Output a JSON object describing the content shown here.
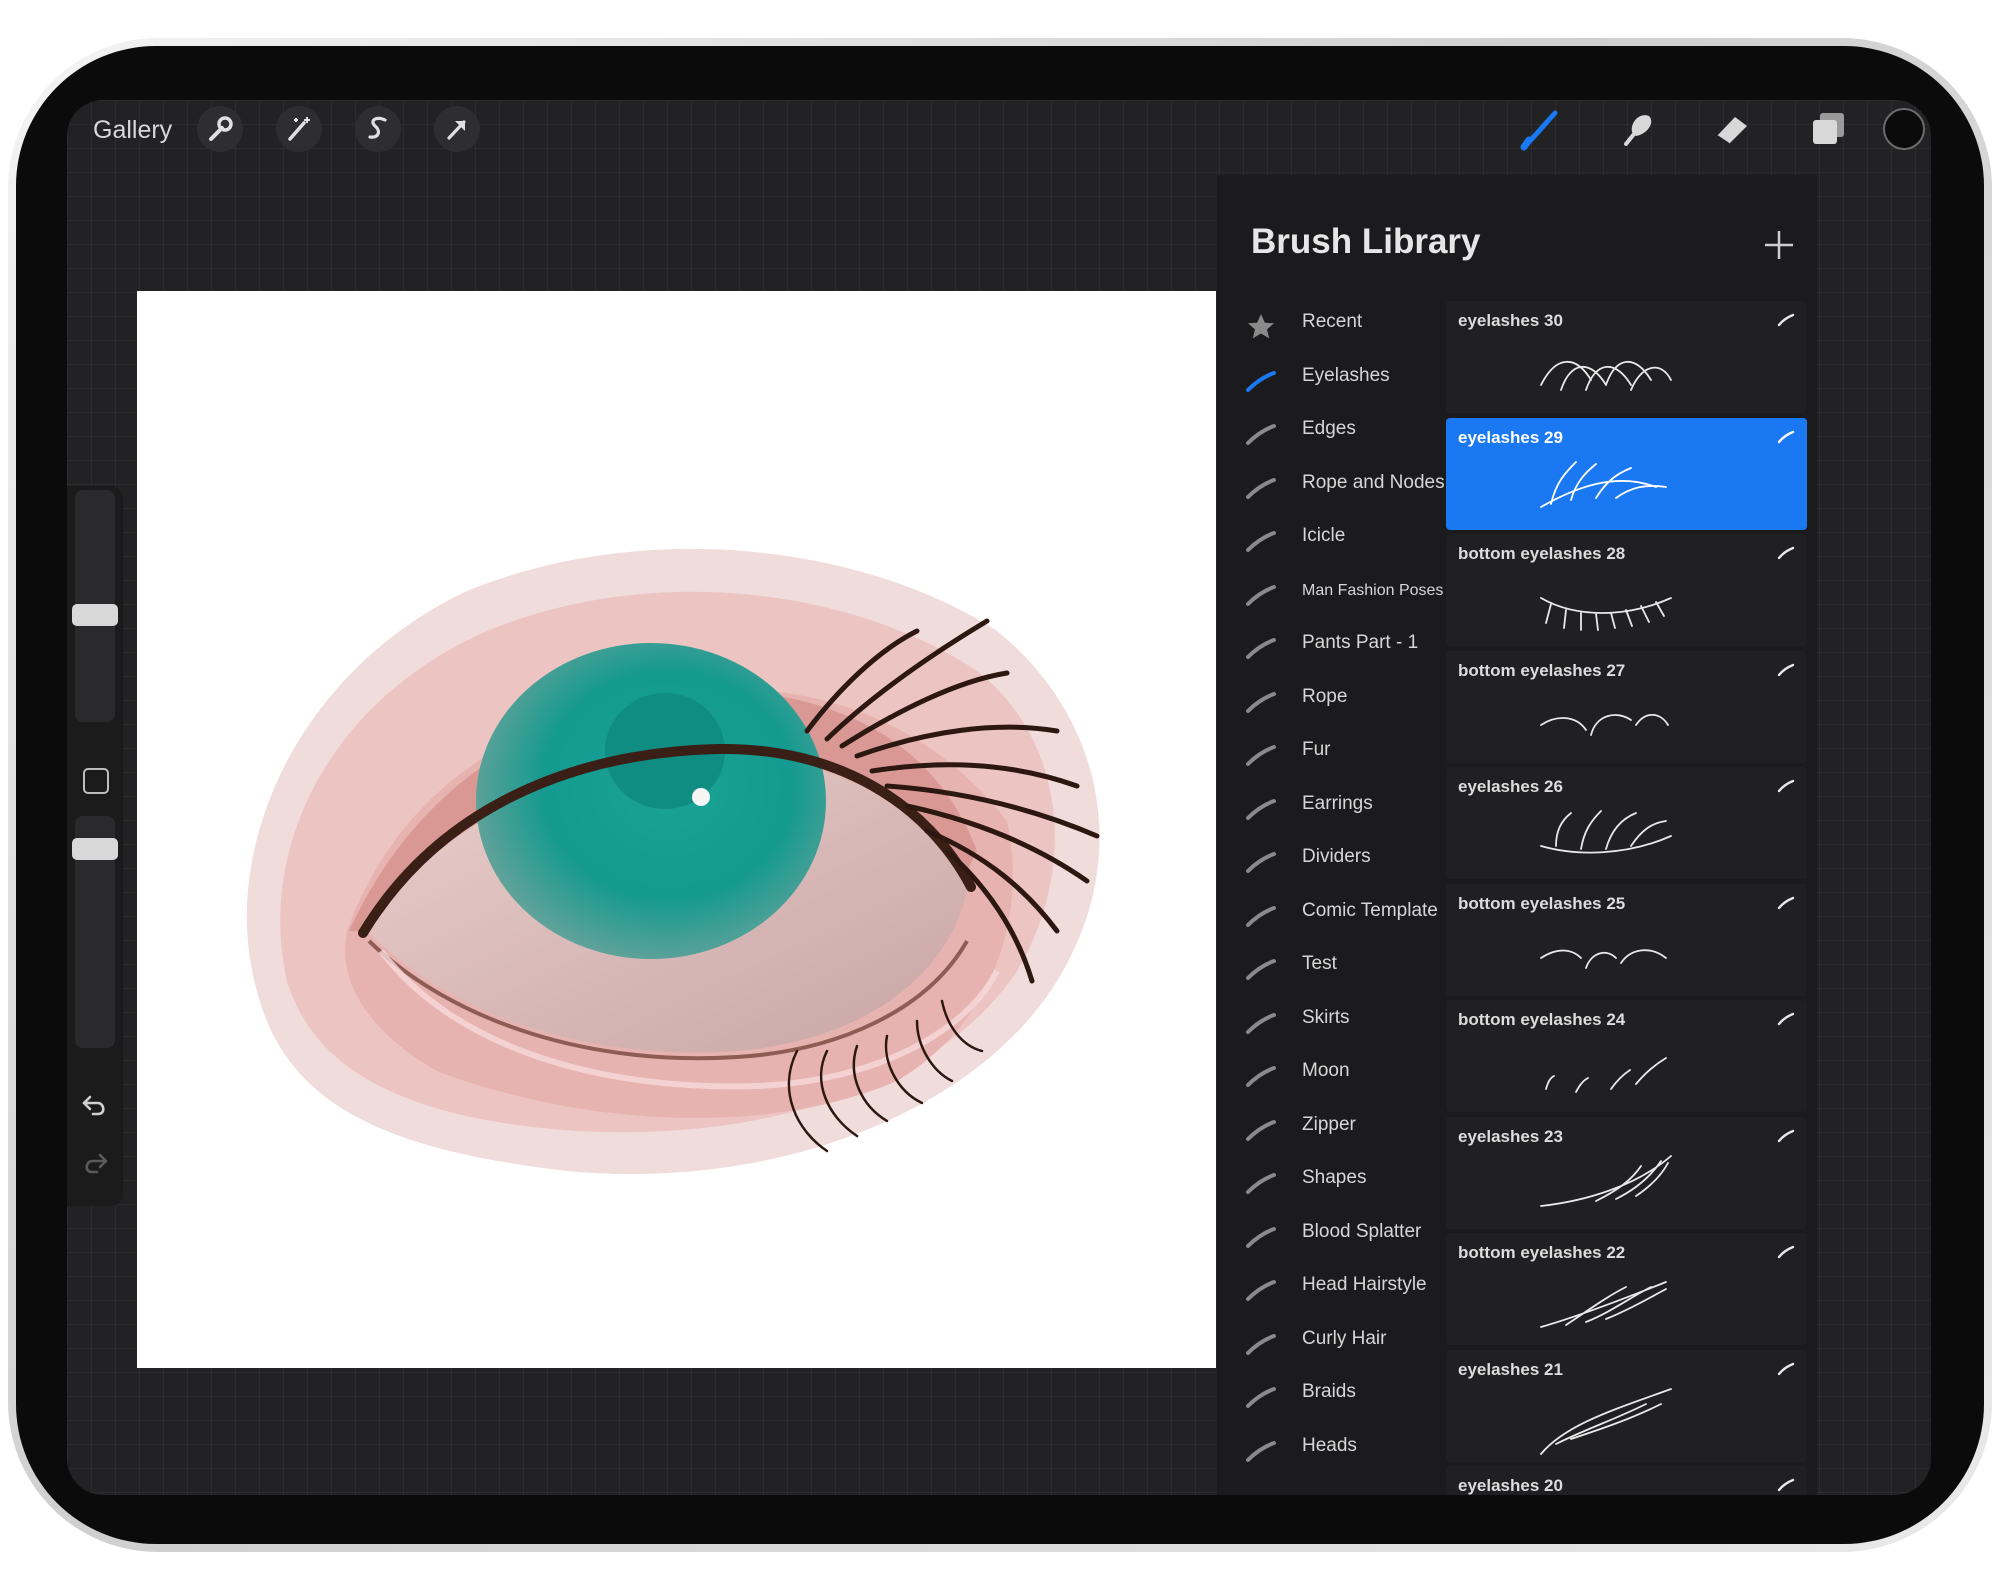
{
  "topbar": {
    "gallery_label": "Gallery",
    "left_icons": [
      "wrench-icon",
      "magic-wand-icon",
      "selection-s-icon",
      "transform-arrow-icon"
    ],
    "right_tools": [
      "paintbrush-icon",
      "smudge-icon",
      "eraser-icon",
      "layers-icon"
    ],
    "active_tool": "paintbrush-icon",
    "active_color": "#0b0b0b",
    "accent_color": "#1a79f2"
  },
  "sidebar": {
    "icons": [
      "brush-size-slider",
      "modify-square-icon",
      "opacity-slider",
      "undo-icon",
      "redo-icon"
    ]
  },
  "canvas": {
    "subject": "painted eye artwork",
    "iris_color": "#149a8f",
    "skin_color": "#e7b3b0"
  },
  "brush_library": {
    "title": "Brush Library",
    "add_icon": "plus-icon",
    "categories": [
      {
        "label": "Recent"
      },
      {
        "label": "Eyelashes"
      },
      {
        "label": "Edges"
      },
      {
        "label": "Rope and Nodes"
      },
      {
        "label": "Icicle"
      },
      {
        "label": "Man Fashion Poses"
      },
      {
        "label": "Pants Part - 1"
      },
      {
        "label": "Rope"
      },
      {
        "label": "Fur"
      },
      {
        "label": "Earrings"
      },
      {
        "label": "Dividers"
      },
      {
        "label": "Comic Template"
      },
      {
        "label": "Test"
      },
      {
        "label": "Skirts"
      },
      {
        "label": "Moon"
      },
      {
        "label": "Zipper"
      },
      {
        "label": "Shapes"
      },
      {
        "label": "Blood Splatter"
      },
      {
        "label": "Head Hairstyle"
      },
      {
        "label": "Curly Hair"
      },
      {
        "label": "Braids"
      },
      {
        "label": "Heads"
      }
    ],
    "selected_category": "Eyelashes",
    "brushes": [
      {
        "name": "eyelashes 30"
      },
      {
        "name": "eyelashes 29"
      },
      {
        "name": "bottom eyelashes 28"
      },
      {
        "name": "bottom eyelashes 27"
      },
      {
        "name": "eyelashes 26"
      },
      {
        "name": "bottom eyelashes 25"
      },
      {
        "name": "bottom eyelashes 24"
      },
      {
        "name": "eyelashes 23"
      },
      {
        "name": "bottom eyelashes 22"
      },
      {
        "name": "eyelashes 21"
      },
      {
        "name": "eyelashes 20"
      }
    ],
    "selected_brush": "eyelashes 29"
  }
}
